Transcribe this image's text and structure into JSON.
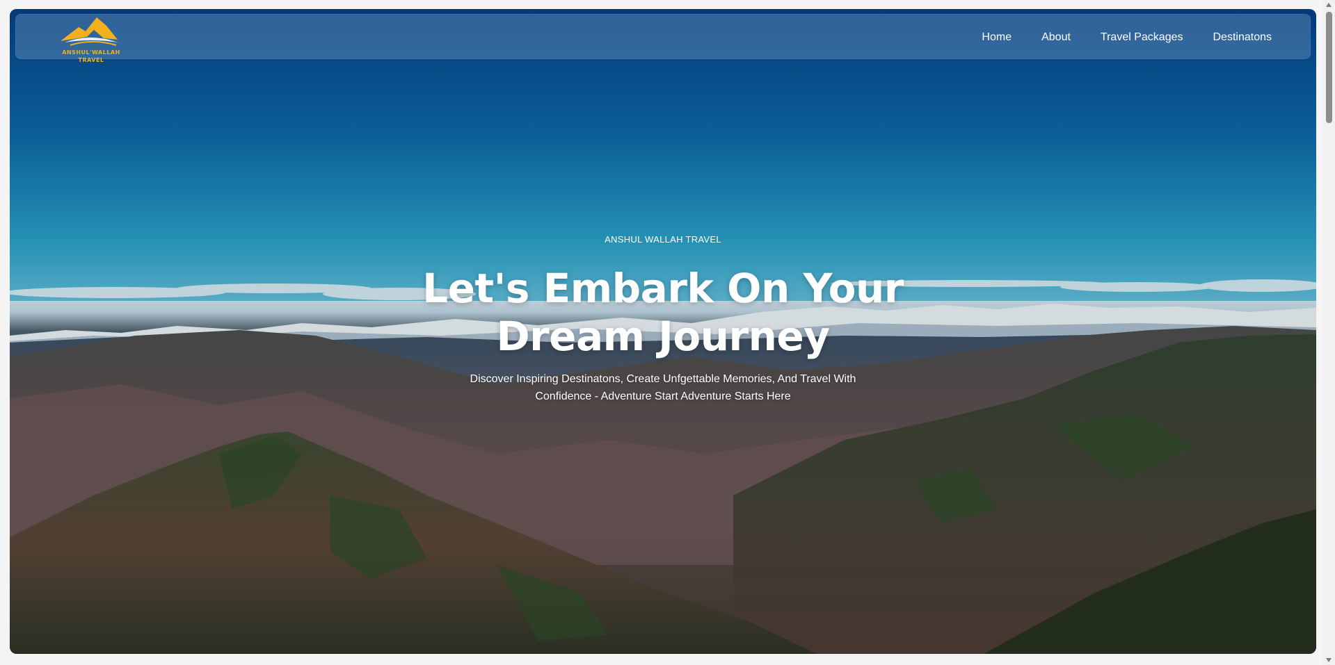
{
  "brand": {
    "logo_icon": "mountain-logo-icon",
    "logo_line1": "ANSHUL'WALLAH",
    "logo_line2": "TRAVEL",
    "accent_color": "#f2b01e"
  },
  "nav": {
    "items": [
      {
        "label": "Home"
      },
      {
        "label": "About"
      },
      {
        "label": "Travel Packages"
      },
      {
        "label": "Destinatons"
      }
    ]
  },
  "hero": {
    "eyebrow": "ANSHUL WALLAH TRAVEL",
    "headline": "Let's Embark On Your Dream Journey",
    "subtitle": "Discover Inspiring Destinatons, Create Unfgettable Memories, And Travel With Confidence - Adventure Start Adventure Starts Here",
    "background_image": "mountain-valley-landscape"
  }
}
